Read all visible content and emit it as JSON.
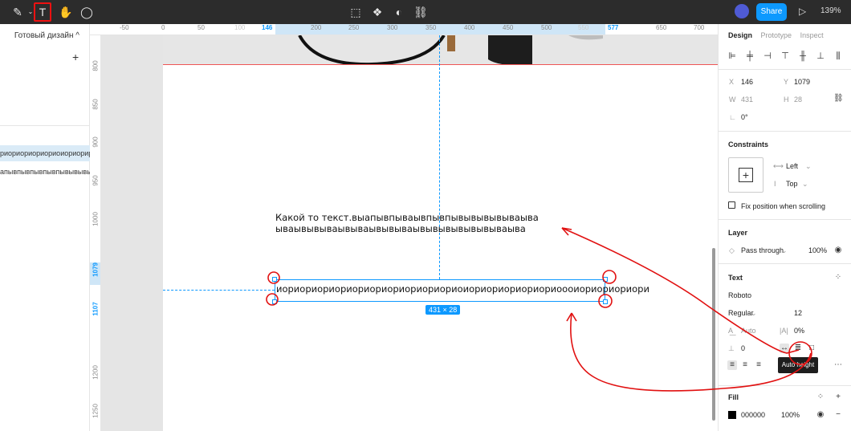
{
  "toolbar": {
    "icons": [
      "pen-icon",
      "text-icon",
      "hand-icon",
      "comment-icon",
      "crop-icon",
      "component-icon",
      "contrast-icon",
      "link-icon"
    ],
    "share_label": "Share",
    "zoom_label": "139%",
    "selected_tool": "text"
  },
  "left_panel": {
    "page_name": "Готовый дизайн ^",
    "layers": [
      {
        "label": "риориориориориоиориорир...",
        "selected": true
      },
      {
        "label": "апывпывпывпывпывывывы...",
        "selected": false
      }
    ]
  },
  "ruler": {
    "h_ticks": [
      "-50",
      "0",
      "50",
      "100",
      "146",
      "200",
      "250",
      "300",
      "350",
      "400",
      "450",
      "500",
      "550",
      "577",
      "650",
      "700"
    ],
    "v_ticks": [
      "800",
      "850",
      "900",
      "950",
      "1000",
      "1079",
      "1107",
      "1200",
      "1250"
    ]
  },
  "canvas": {
    "text_line1": "Какой то текст.выапывпываывпывпывывывывываыва",
    "text_line2": "ываывывываывываывывываывывывывывывываыва",
    "selected_text": "иориориориориориориориориориориоиориориориориориоооиориориориори",
    "size_badge": "431 × 28"
  },
  "design_panel": {
    "tabs": [
      "Design",
      "Prototype",
      "Inspect"
    ],
    "x_label": "X",
    "x_value": "146",
    "y_label": "Y",
    "y_value": "1079",
    "w_label": "W",
    "w_value": "431",
    "h_label": "H",
    "h_value": "28",
    "rotation": "0°",
    "constraints_title": "Constraints",
    "constraint_h": "Left",
    "constraint_v": "Top",
    "fix_position_label": "Fix position when scrolling",
    "layer_title": "Layer",
    "blend_mode": "Pass through",
    "opacity": "100%",
    "text_title": "Text",
    "font_family": "Roboto",
    "font_weight": "Regular",
    "font_size": "12",
    "line_height": "Auto",
    "letter_spacing": "0%",
    "paragraph_spacing": "0",
    "tooltip": "Auto height",
    "fill_title": "Fill",
    "fill_hex": "000000",
    "fill_opacity": "100%"
  },
  "colors": {
    "accent": "#0d99ff",
    "annotation_red": "#e11111",
    "topbar": "#2c2c2c"
  }
}
